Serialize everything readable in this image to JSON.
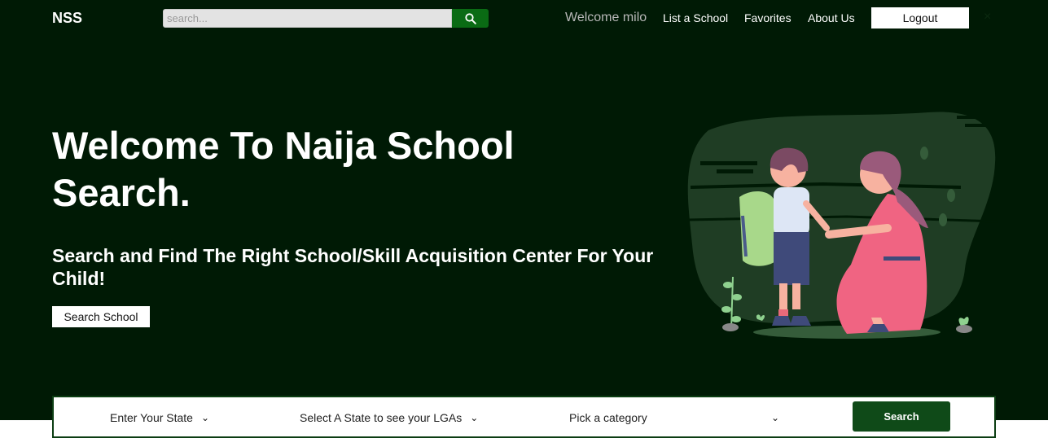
{
  "nav": {
    "brand": "NSS",
    "search_placeholder": "search...",
    "welcome": "Welcome milo",
    "links": [
      "List a School",
      "Favorites",
      "About Us"
    ],
    "logout": "Logout",
    "close": "×"
  },
  "hero": {
    "title": "Welcome To Naija School Search.",
    "subtitle": "Search and Find The Right School/Skill Acquisition Center For Your Child!",
    "button": "Search School"
  },
  "filters": {
    "state": "Enter Your State",
    "lga": "Select A State to see your LGAs",
    "category": "Pick a category",
    "search_button": "Search"
  },
  "colors": {
    "background": "#001a05",
    "accent": "#0a6b14",
    "filter_button": "#0f4a18"
  }
}
